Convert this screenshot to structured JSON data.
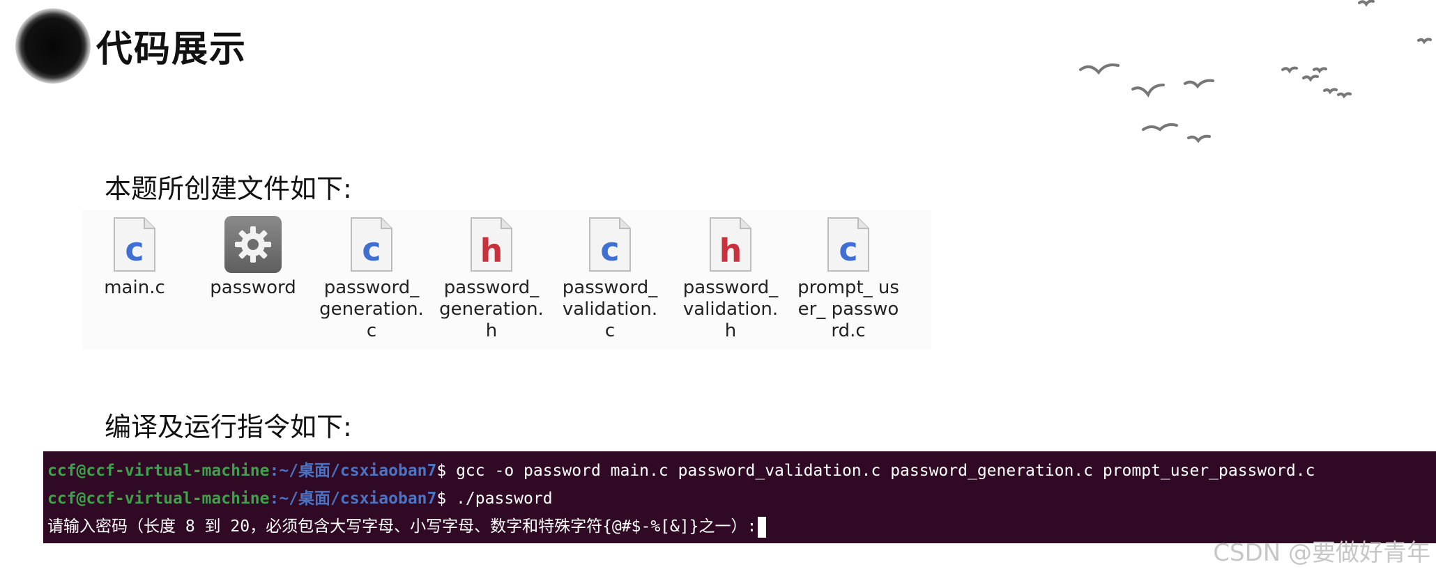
{
  "header": {
    "title": "代码展示"
  },
  "sections": {
    "files_label": "本题所创建文件如下:",
    "commands_label": "编译及运行指令如下:"
  },
  "files": [
    {
      "name": "main.c",
      "icon": "c-file-icon"
    },
    {
      "name": "password",
      "icon": "executable-gear-icon"
    },
    {
      "name": "password_ generation. c",
      "icon": "c-file-icon"
    },
    {
      "name": "password_ generation. h",
      "icon": "h-file-icon"
    },
    {
      "name": "password_ validation.c",
      "icon": "c-file-icon"
    },
    {
      "name": "password_ validation.h",
      "icon": "h-file-icon"
    },
    {
      "name": "prompt_ user_ password.c",
      "icon": "c-file-icon"
    }
  ],
  "terminal": {
    "user_host": "ccf@ccf-virtual-machine",
    "path": ":~/桌面/csxiaoban7",
    "prompt_symbol": "$ ",
    "line1_cmd": "gcc -o password main.c password_validation.c password_generation.c prompt_user_password.c",
    "line2_cmd": "./password",
    "line3_output": "请输入密码（长度 8 到 20，必须包含大写字母、小写字母、数字和特殊字符{@#$-%[&]}之一）:"
  },
  "colors": {
    "terminal_bg": "#300a24",
    "user_host": "#3ea04a",
    "path": "#4a73c4",
    "c_letter": "#3f6fd1",
    "h_letter": "#c8323c"
  },
  "watermark": "CSDN @要做好青年"
}
